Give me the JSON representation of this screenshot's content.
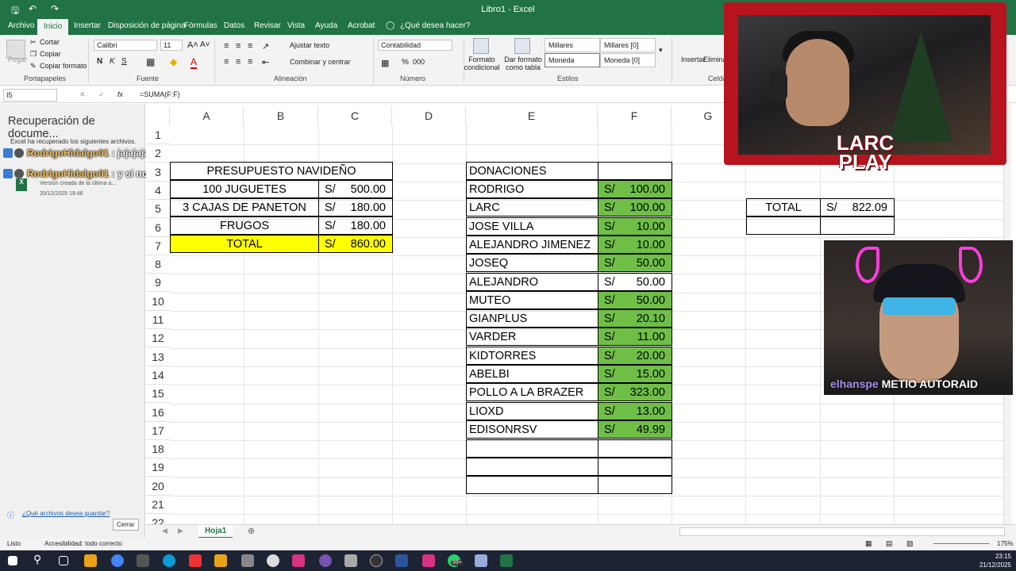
{
  "titlebar": {
    "doc_title": "Libro1  -  Excel"
  },
  "tabs": [
    {
      "label": "Archivo"
    },
    {
      "label": "Inicio"
    },
    {
      "label": "Insertar"
    },
    {
      "label": "Disposición de página"
    },
    {
      "label": "Fórmulas"
    },
    {
      "label": "Datos"
    },
    {
      "label": "Revisar"
    },
    {
      "label": "Vista"
    },
    {
      "label": "Ayuda"
    },
    {
      "label": "Acrobat"
    },
    {
      "label": "¿Qué desea hacer?"
    }
  ],
  "ribbon": {
    "clipboard": {
      "paste": "Pegar",
      "cut": "Cortar",
      "copy": "Copiar",
      "format_painter": "Copiar formato",
      "label": "Portapapeles"
    },
    "font": {
      "name": "Calibri",
      "size": "11",
      "bold": "N",
      "italic": "K",
      "underline": "S",
      "label": "Fuente"
    },
    "alignment": {
      "wrap": "Ajustar texto",
      "merge": "Combinar y centrar",
      "label": "Alineación"
    },
    "number": {
      "format": "Contabilidad",
      "percent": "%",
      "comma": "000",
      "label": "Número"
    },
    "styles": {
      "cond_format": "Formato condicional",
      "table_format": "Dar formato como tabla",
      "cells": [
        "Millares",
        "Millares [0]",
        "Moneda",
        "Moneda [0]"
      ],
      "label": "Estilos"
    },
    "cells": {
      "insert": "Insertar",
      "delete": "Eliminar",
      "label": "Celdas"
    }
  },
  "formula_bar": {
    "name_box": "I5",
    "fx": "fx",
    "formula": "=SUMA(F:F)"
  },
  "recovery": {
    "title": "Recuperación de docume...",
    "message": "Excel ha recuperado los siguientes archivos.",
    "file_version": "Versión creada de la última a...",
    "file_date": "20/12/2025 19:46",
    "which_files": "¿Qué archivos desea guardar?",
    "close": "Cerrar"
  },
  "chat": [
    {
      "user": "RodrigoHidalgo01",
      "text": " : jajajaja"
    },
    {
      "user": "RodrigoHidalgo01",
      "text": " : y si no sale"
    }
  ],
  "columns": [
    "A",
    "B",
    "C",
    "D",
    "E",
    "F",
    "G"
  ],
  "rows": [
    "1",
    "2",
    "3",
    "4",
    "5",
    "6",
    "7",
    "8",
    "9",
    "10",
    "11",
    "12",
    "13",
    "14",
    "15",
    "16",
    "17",
    "18",
    "19",
    "20",
    "21",
    "22"
  ],
  "budget": {
    "title": "PRESUPUESTO NAVIDEÑO",
    "items": [
      {
        "label": "100 JUGUETES",
        "currency": "S/",
        "amount": "500.00"
      },
      {
        "label": "3 CAJAS DE PANETON",
        "currency": "S/",
        "amount": "180.00"
      },
      {
        "label": "FRUGOS",
        "currency": "S/",
        "amount": "180.00"
      }
    ],
    "total_label": "TOTAL",
    "total_currency": "S/",
    "total_amount": "860.00"
  },
  "donations": {
    "title": "DONACIONES",
    "items": [
      {
        "name": "RODRIGO",
        "currency": "S/",
        "amount": "100.00",
        "paid": true
      },
      {
        "name": "LARC",
        "currency": "S/",
        "amount": "100.00",
        "paid": true
      },
      {
        "name": "JOSE VILLA",
        "currency": "S/",
        "amount": "10.00",
        "paid": true
      },
      {
        "name": "ALEJANDRO JIMENEZ",
        "currency": "S/",
        "amount": "10.00",
        "paid": true
      },
      {
        "name": "JOSEQ",
        "currency": "S/",
        "amount": "50.00",
        "paid": true
      },
      {
        "name": "ALEJANDRO",
        "currency": "S/",
        "amount": "50.00",
        "paid": false
      },
      {
        "name": "MUTEO",
        "currency": "S/",
        "amount": "50.00",
        "paid": true
      },
      {
        "name": "GIANPLUS",
        "currency": "S/",
        "amount": "20.10",
        "paid": true
      },
      {
        "name": "VARDER",
        "currency": "S/",
        "amount": "11.00",
        "paid": true
      },
      {
        "name": "KIDTORRES",
        "currency": "S/",
        "amount": "20.00",
        "paid": true
      },
      {
        "name": "ABELBI",
        "currency": "S/",
        "amount": "15.00",
        "paid": true
      },
      {
        "name": "POLLO A LA BRAZER",
        "currency": "S/",
        "amount": "323.00",
        "paid": true
      },
      {
        "name": "LIOXD",
        "currency": "S/",
        "amount": "13.00",
        "paid": true
      },
      {
        "name": "EDISONRSV",
        "currency": "S/",
        "amount": "49.99",
        "paid": true
      }
    ]
  },
  "summary": {
    "label": "TOTAL",
    "currency": "S/",
    "amount": "822.09"
  },
  "sheet": {
    "tab": "Hoja1"
  },
  "status": {
    "ready": "Listo",
    "accessibility": "Accesibilidad: todo correcto",
    "zoom": "175%"
  },
  "taskbar": {
    "time": "23:15",
    "date": "21/12/2025",
    "badge": "99+"
  },
  "overlays": {
    "logo_line1": "LARC",
    "logo_line2": "PLAY",
    "raid_user": "elhanspe",
    "raid_text": " METIO AUTORAID"
  },
  "colors": {
    "excel_green": "#217346",
    "paid_green": "#6fbf47",
    "total_yellow": "#ffff00",
    "frame_red": "#b8141e"
  }
}
